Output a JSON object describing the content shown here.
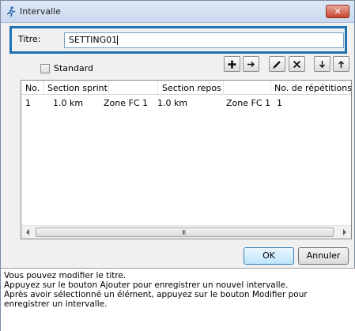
{
  "window": {
    "title": "Intervalle",
    "close_glyph": "✕"
  },
  "title_field": {
    "label": "Titre:",
    "value": "SETTING01"
  },
  "standard": {
    "label": "Standard",
    "checked": false
  },
  "toolbar": {
    "buttons": [
      {
        "icon": "plus-icon"
      },
      {
        "icon": "arrow-right-icon"
      },
      {
        "icon": "pencil-icon"
      },
      {
        "icon": "delete-x-icon"
      },
      {
        "icon": "arrow-down-icon"
      },
      {
        "icon": "arrow-up-icon"
      }
    ]
  },
  "table": {
    "headers": [
      "No.",
      "Section sprint",
      "Section repos",
      "No. de répétitions"
    ],
    "rows": [
      [
        "1",
        "1.0 km",
        "Zone FC 1",
        "1.0 km",
        "Zone FC 1",
        "1"
      ]
    ]
  },
  "scrollbar": {
    "grip": "III"
  },
  "buttons": {
    "ok": "OK",
    "cancel": "Annuler"
  },
  "help": {
    "line1": "Vous pouvez modifier le titre.",
    "line2": "Appuyez sur le bouton Ajouter pour enregistrer un nouvel intervalle.",
    "line3": "Après avoir sélectionné un élément, appuyez sur le bouton Modifier pour enregistrer un intervalle."
  },
  "colors": {
    "focus_border": "#1e73b4",
    "close_button": "#c7432e"
  }
}
